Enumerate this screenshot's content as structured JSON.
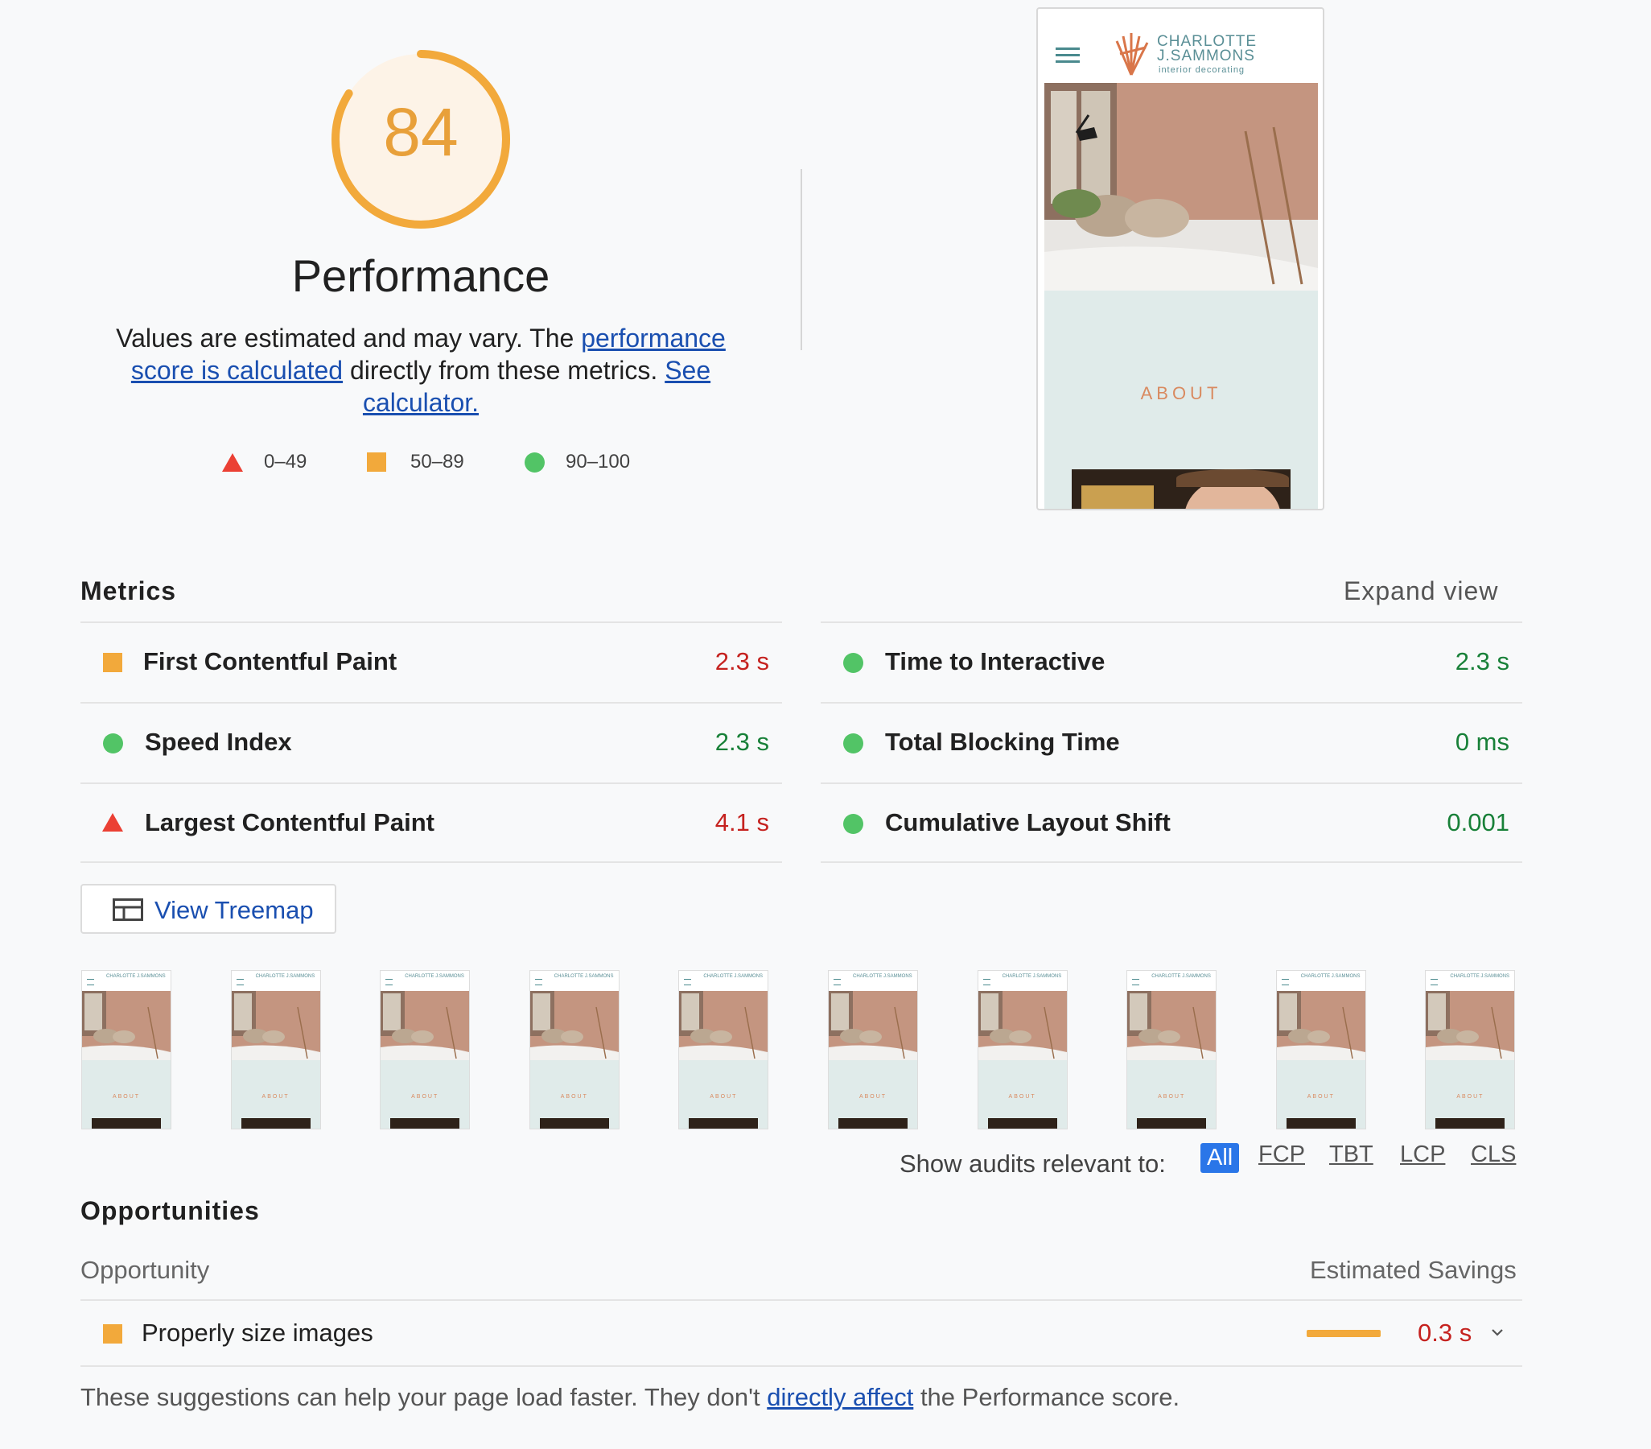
{
  "score": {
    "value": "84",
    "fraction": 0.84,
    "color": "#f2a93b",
    "title": "Performance",
    "description_prefix": "Values are estimated and may vary. The ",
    "description_link1": "performance score is calculated",
    "description_middle": " directly from these metrics. ",
    "description_link2": "See calculator."
  },
  "legend": [
    {
      "icon": "triangle-red-icon",
      "label": "0–49",
      "color": "#eb4034"
    },
    {
      "icon": "square-orange-icon",
      "label": "50–89",
      "color": "#f2a93b"
    },
    {
      "icon": "circle-green-icon",
      "label": "90–100",
      "color": "#52c466"
    }
  ],
  "preview": {
    "brand_line1": "CHARLOTTE",
    "brand_line2": "J.SAMMONS",
    "brand_tagline": "interior decorating",
    "section_heading": "ABOUT"
  },
  "metrics": {
    "title": "Metrics",
    "expand_label": "Expand view",
    "items": [
      {
        "name": "First Contentful Paint",
        "value": "2.3 s",
        "rating": "average"
      },
      {
        "name": "Time to Interactive",
        "value": "2.3 s",
        "rating": "pass"
      },
      {
        "name": "Speed Index",
        "value": "2.3 s",
        "rating": "pass"
      },
      {
        "name": "Total Blocking Time",
        "value": "0 ms",
        "rating": "pass"
      },
      {
        "name": "Largest Contentful Paint",
        "value": "4.1 s",
        "rating": "fail"
      },
      {
        "name": "Cumulative Layout Shift",
        "value": "0.001",
        "rating": "pass"
      }
    ]
  },
  "treemap": {
    "label": "View Treemap"
  },
  "filmstrip_count": 10,
  "audit_filter": {
    "label": "Show audits relevant to:",
    "options": [
      "All",
      "FCP",
      "TBT",
      "LCP",
      "CLS"
    ],
    "selected": "All"
  },
  "opportunities": {
    "title": "Opportunities",
    "col_opportunity": "Opportunity",
    "col_savings": "Estimated Savings",
    "items": [
      {
        "name": "Properly size images",
        "savings": "0.3 s",
        "rating": "average"
      }
    ],
    "footer_prefix": "These suggestions can help your page load faster. They don't ",
    "footer_link": "directly affect",
    "footer_suffix": " the Performance score."
  },
  "colors": {
    "fail": "#eb4034",
    "average": "#f2a93b",
    "pass": "#52c466",
    "link": "#1a4fb0"
  }
}
